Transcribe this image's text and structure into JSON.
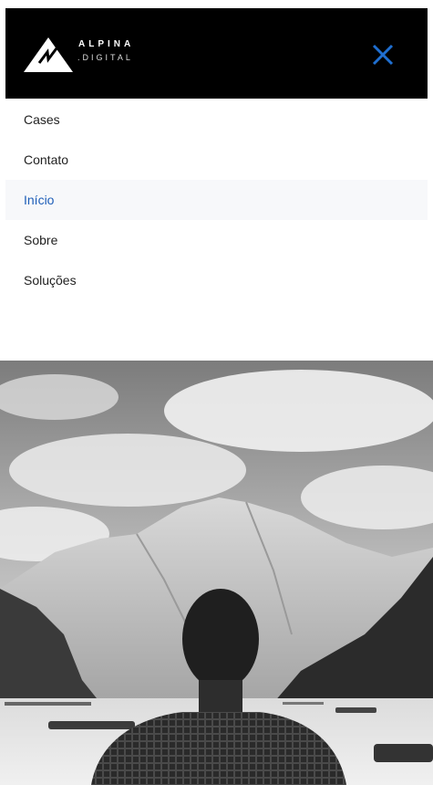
{
  "brand": {
    "name": "ALPINA",
    "sub": ".DIGITAL",
    "logo_icon": "mountain-icon"
  },
  "header": {
    "background": "#000000",
    "close_icon": "close-icon",
    "close_color": "#1f6fd1"
  },
  "menu": {
    "items": [
      {
        "label": "Cases"
      },
      {
        "label": "Contato"
      },
      {
        "label": "Início",
        "active": true
      },
      {
        "label": "Sobre"
      },
      {
        "label": "Soluções"
      }
    ],
    "active_color": "#1f5fb8",
    "active_background": "#f7f8fa"
  },
  "hero": {
    "image": "black-and-white photo: man looking at a mountain lake with boats"
  }
}
